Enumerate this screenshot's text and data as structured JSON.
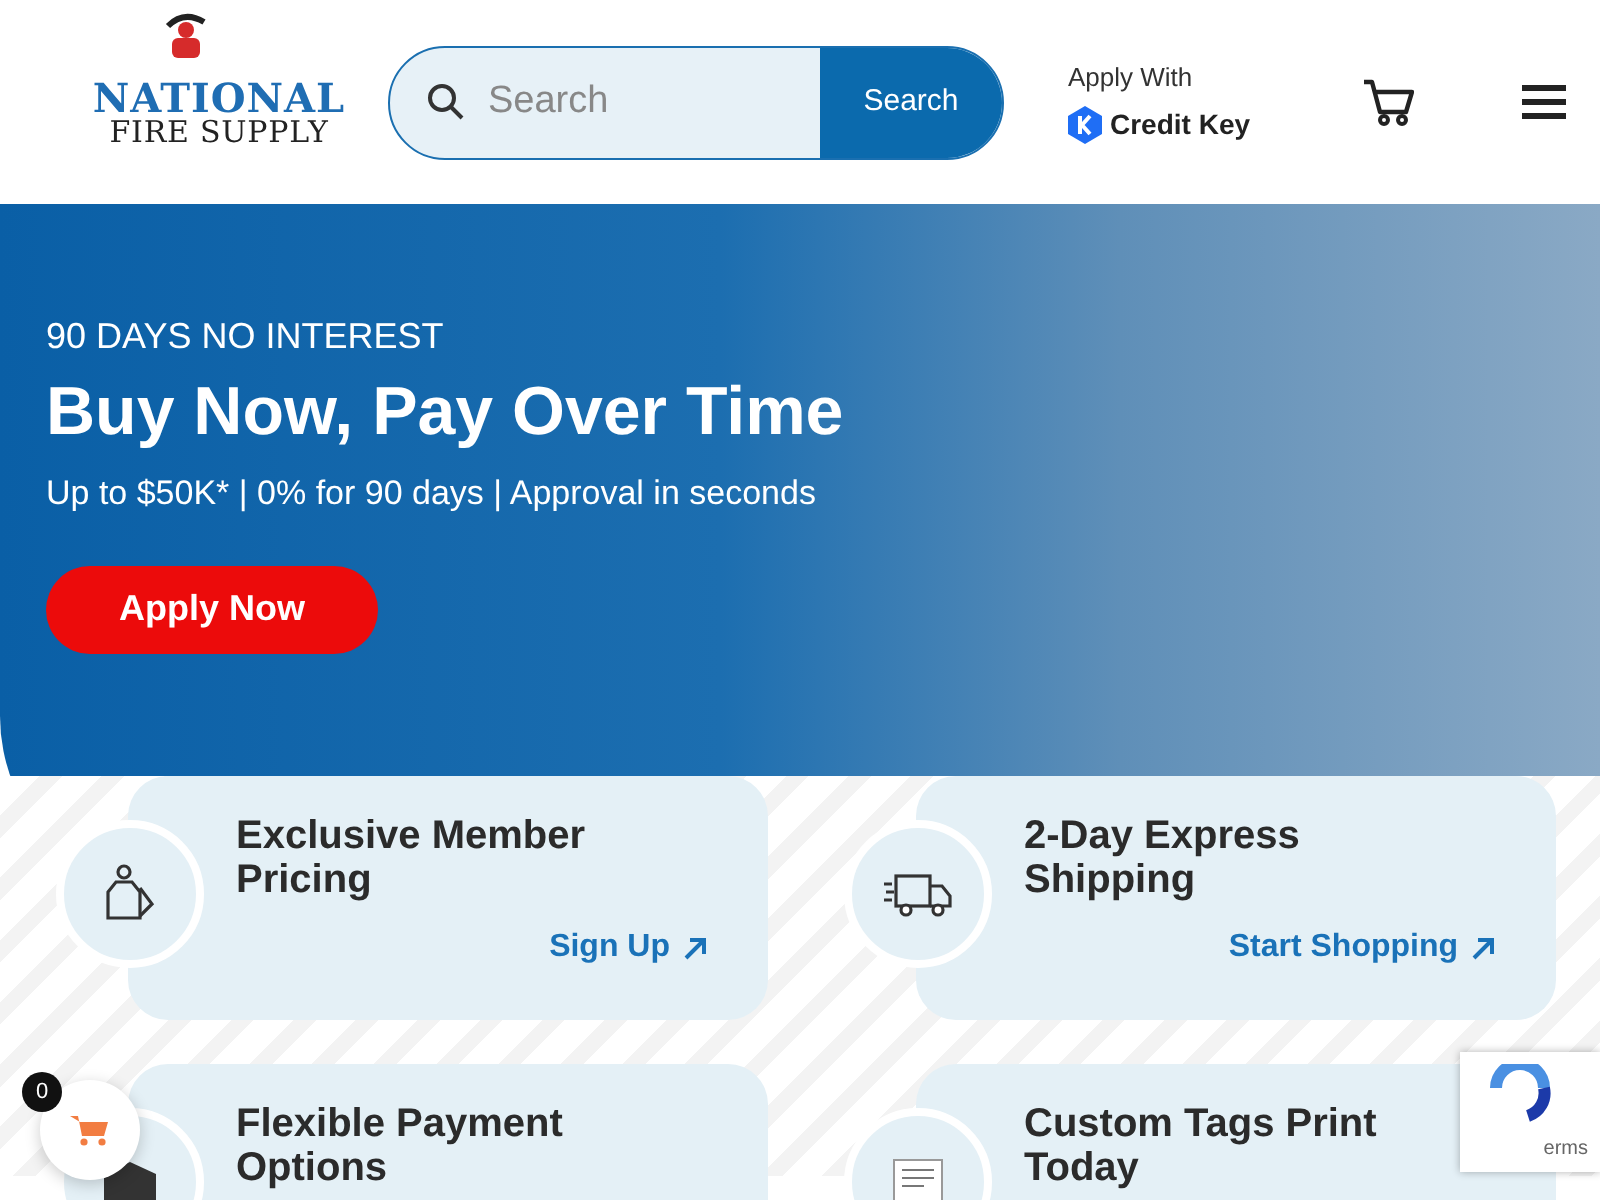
{
  "header": {
    "logo": {
      "line_1": "NATIONAL",
      "line_2": "FIRE SUPPLY"
    },
    "search": {
      "placeholder": "Search",
      "button": "Search"
    },
    "financing": {
      "label": "Apply With",
      "brand": "Credit Key"
    }
  },
  "hero": {
    "eyebrow": "90 DAYS NO INTEREST",
    "title": "Buy Now, Pay Over Time",
    "subtitle": "Up to $50K* | 0% for 90 days | Approval in seconds",
    "button": "Apply Now"
  },
  "features": [
    {
      "kind": "tag",
      "title": "Exclusive Member Pricing",
      "link": "Sign Up"
    },
    {
      "kind": "truck",
      "title": "2-Day Express Shipping",
      "link": "Start Shopping"
    },
    {
      "kind": "box",
      "title": "Flexible Payment Options"
    },
    {
      "kind": "document",
      "title": "Custom Tags Print Today"
    }
  ],
  "floating_cart": {
    "count": "0"
  },
  "recaptcha": {
    "text": "erms"
  }
}
